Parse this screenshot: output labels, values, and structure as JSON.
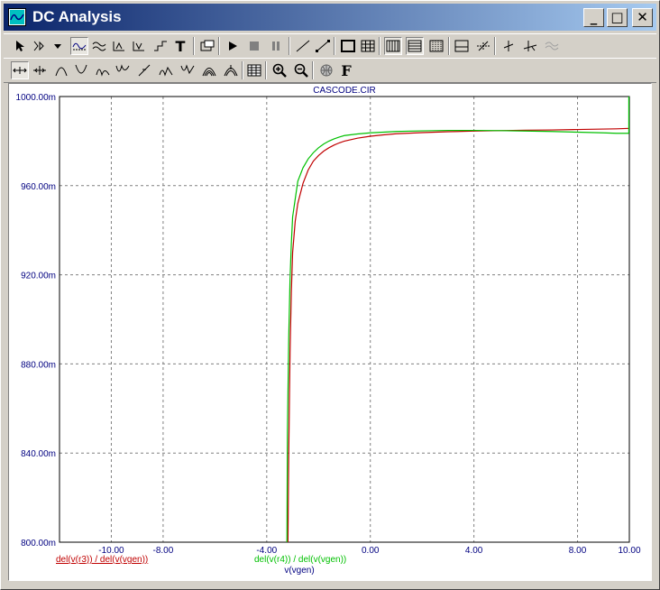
{
  "window": {
    "title": "DC Analysis"
  },
  "title_buttons": {
    "minimize": "_",
    "maximize": "□",
    "close": "✕"
  },
  "toolbar1": [
    "pointer-icon",
    "node-select-icon",
    "dropdown-icon",
    "waveform-icon",
    "multi-wave-icon",
    "peak-icon",
    "valley-icon",
    "step-icon",
    "text-icon",
    "properties-icon",
    "run-icon",
    "stop-icon",
    "pause-icon",
    "slope-icon",
    "ramp-icon",
    "frame-icon",
    "grid-icon",
    "vgrid-icon",
    "hgrid-icon",
    "dots-grid-icon",
    "hline-icon",
    "cross-icon",
    "cursor-icon",
    "cursor-pair-icon",
    "wave-off-icon"
  ],
  "toolbar2": [
    "cursor-left-icon",
    "cursor-right-icon",
    "peak-cursor-icon",
    "valley-cursor-icon",
    "high-cursor-icon",
    "low-cursor-icon",
    "slope-cursor-icon",
    "min-cursor-icon",
    "max-cursor-icon",
    "inflection-icon",
    "point-icon",
    "table-icon",
    "zoom-in-icon",
    "zoom-out-icon",
    "globe-icon",
    "font-icon"
  ],
  "font_button_label": "F",
  "text_button_label": "T",
  "chart_data": {
    "type": "line",
    "title": "CASCODE.CIR",
    "xlabel": "v(vgen)",
    "xlim": [
      -12,
      10
    ],
    "ylim": [
      0.8,
      1.0
    ],
    "x_ticks": [
      -10,
      -8,
      -4,
      0,
      4,
      8,
      10
    ],
    "x_tick_labels": [
      "-10.00",
      "-8.00",
      "-4.00",
      "0.00",
      "4.00",
      "8.00",
      "10.00"
    ],
    "y_ticks": [
      0.8,
      0.84,
      0.88,
      0.92,
      0.96,
      1.0
    ],
    "y_tick_labels": [
      "800.00m",
      "840.00m",
      "880.00m",
      "920.00m",
      "960.00m",
      "1000.00m"
    ],
    "grid": true,
    "grid_x": [
      -10,
      -8,
      -4,
      0,
      4,
      8
    ],
    "grid_y": [
      0.84,
      0.88,
      0.92,
      0.96
    ],
    "series": [
      {
        "name": "del(v(r3)) / del(v(vgen))",
        "color": "#c00000",
        "x": [
          -3.18,
          -3.15,
          -3.1,
          -3.05,
          -3.0,
          -2.9,
          -2.8,
          -2.6,
          -2.4,
          -2.2,
          -2.0,
          -1.8,
          -1.6,
          -1.4,
          -1.2,
          -1.0,
          -0.5,
          0.0,
          0.5,
          1.0,
          2.0,
          3.0,
          4.0,
          5.0,
          6.0,
          7.0,
          8.0,
          9.0,
          9.5,
          10.0
        ],
        "y": [
          0.8,
          0.84,
          0.885,
          0.912,
          0.93,
          0.944,
          0.952,
          0.961,
          0.967,
          0.971,
          0.9735,
          0.9755,
          0.977,
          0.9782,
          0.9792,
          0.98,
          0.9813,
          0.9822,
          0.9828,
          0.9833,
          0.9838,
          0.9842,
          0.9845,
          0.9847,
          0.9849,
          0.985,
          0.9852,
          0.9854,
          0.9855,
          0.9857
        ]
      },
      {
        "name": "del(v(r4)) / del(v(vgen))",
        "color": "#00c000",
        "x": [
          -3.22,
          -3.2,
          -3.15,
          -3.1,
          -3.05,
          -3.0,
          -2.9,
          -2.8,
          -2.6,
          -2.4,
          -2.2,
          -2.0,
          -1.8,
          -1.6,
          -1.4,
          -1.2,
          -1.0,
          -0.5,
          0.0,
          0.5,
          1.0,
          2.0,
          3.0,
          4.0,
          5.0,
          6.0,
          7.0,
          8.0,
          9.0,
          9.5,
          9.98
        ],
        "y": [
          0.8,
          0.85,
          0.892,
          0.918,
          0.934,
          0.946,
          0.954,
          0.962,
          0.968,
          0.972,
          0.9748,
          0.977,
          0.9787,
          0.98,
          0.981,
          0.9818,
          0.9825,
          0.9832,
          0.9837,
          0.984,
          0.9843,
          0.9846,
          0.9848,
          0.9848,
          0.9847,
          0.9845,
          0.9843,
          0.984,
          0.9837,
          0.9835,
          0.9835
        ]
      }
    ],
    "legend": [
      {
        "label": "del(v(r3)) / del(v(vgen))",
        "color": "#c00000"
      },
      {
        "label": "del(v(r4)) / del(v(vgen))",
        "color": "#00c000"
      }
    ],
    "colors": {
      "axis_text": "#000080",
      "grid": "#808080",
      "background": "#ffffff"
    }
  }
}
